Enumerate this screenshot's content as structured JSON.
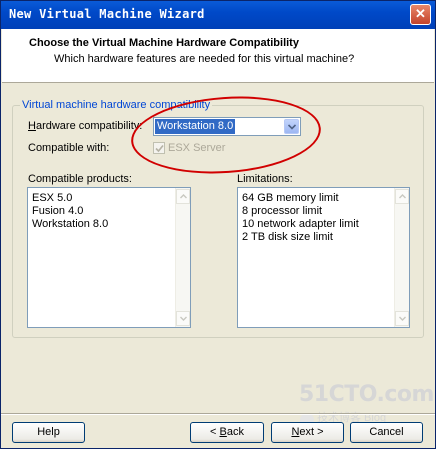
{
  "window": {
    "title": "New Virtual Machine Wizard",
    "close_glyph": "✕"
  },
  "header": {
    "title": "Choose the Virtual Machine Hardware Compatibility",
    "subtitle": "Which hardware features are needed for this virtual machine?"
  },
  "group": {
    "legend": "Virtual machine hardware compatibility",
    "hardware_label_prefix": "",
    "hardware_label_access": "H",
    "hardware_label_rest": "ardware compatibility:",
    "hardware_value": "Workstation 8.0",
    "compatible_label": "Compatible with:",
    "compatible_checked": true,
    "compatible_option": "ESX Server"
  },
  "products": {
    "label": "Compatible products:",
    "items": [
      "ESX 5.0",
      "Fusion 4.0",
      "Workstation 8.0"
    ]
  },
  "limitations": {
    "label": "Limitations:",
    "items": [
      "64 GB memory limit",
      "8 processor limit",
      "10 network adapter limit",
      "2 TB disk size limit"
    ]
  },
  "buttons": {
    "help": "Help",
    "back_prefix": "< ",
    "back_access": "B",
    "back_rest": "ack",
    "next_access": "N",
    "next_rest": "ext >",
    "cancel": "Cancel"
  },
  "watermark": {
    "site": "51CTO.com",
    "sub": "技术博客  Blog"
  },
  "colors": {
    "titlebar": "#0049c8",
    "legend": "#0046d5",
    "selection": "#316ac5",
    "annotation_oval": "#d10000"
  },
  "icons": [
    "close-icon",
    "chevron-down-icon",
    "check-icon",
    "scroll-up-icon",
    "scroll-down-icon"
  ]
}
